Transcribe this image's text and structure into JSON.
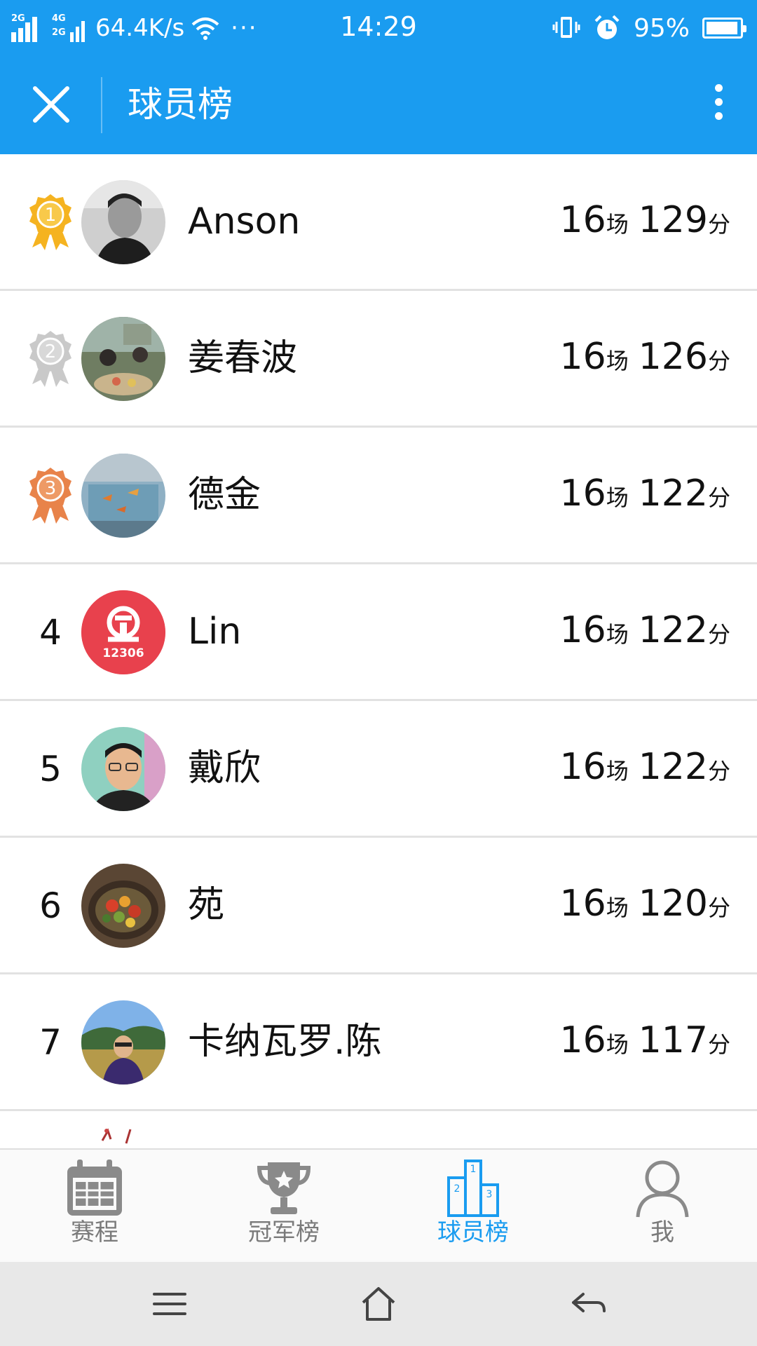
{
  "status_bar": {
    "network_top": "2G",
    "network_mid": "4G",
    "network_bottom": "2G",
    "speed": "64.4K/s",
    "dots": "···",
    "time": "14:29",
    "battery_percent": "95%",
    "battery_level": 0.95
  },
  "title_bar": {
    "title": "球员榜",
    "close_icon": "close-icon",
    "more_icon": "more-vertical-icon"
  },
  "colors": {
    "brand": "#1a9cf0",
    "gold": "#f5b320",
    "silver": "#c9c9c9",
    "bronze": "#e8834a"
  },
  "players": [
    {
      "rank": "1",
      "medal": "gold",
      "name": "Anson",
      "games": "16",
      "games_unit": "场",
      "points": "129",
      "points_unit": "分"
    },
    {
      "rank": "2",
      "medal": "silver",
      "name": "姜春波",
      "games": "16",
      "games_unit": "场",
      "points": "126",
      "points_unit": "分"
    },
    {
      "rank": "3",
      "medal": "bronze",
      "name": "德金",
      "games": "16",
      "games_unit": "场",
      "points": "122",
      "points_unit": "分"
    },
    {
      "rank": "4",
      "medal": "",
      "name": "Lin",
      "avatar_text": "12306",
      "games": "16",
      "games_unit": "场",
      "points": "122",
      "points_unit": "分"
    },
    {
      "rank": "5",
      "medal": "",
      "name": "戴欣",
      "games": "16",
      "games_unit": "场",
      "points": "122",
      "points_unit": "分"
    },
    {
      "rank": "6",
      "medal": "",
      "name": "苑",
      "games": "16",
      "games_unit": "场",
      "points": "120",
      "points_unit": "分"
    },
    {
      "rank": "7",
      "medal": "",
      "name": "卡纳瓦罗.陈",
      "games": "16",
      "games_unit": "场",
      "points": "117",
      "points_unit": "分"
    }
  ],
  "tabs": [
    {
      "label": "赛程",
      "icon": "calendar-icon",
      "active": false
    },
    {
      "label": "冠军榜",
      "icon": "trophy-icon",
      "active": false
    },
    {
      "label": "球员榜",
      "icon": "podium-icon",
      "active": true
    },
    {
      "label": "我",
      "icon": "person-icon",
      "active": false
    }
  ],
  "nav_bar": {
    "menu_icon": "menu-icon",
    "home_icon": "home-icon",
    "back_icon": "back-icon"
  }
}
